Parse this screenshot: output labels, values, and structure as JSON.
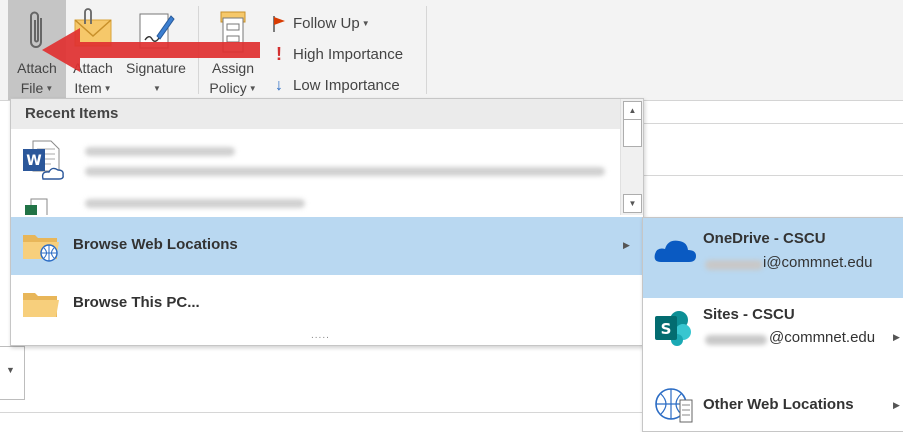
{
  "ribbon": {
    "attach_file": {
      "line1": "Attach",
      "line2": "File",
      "icon": "paperclip-icon"
    },
    "attach_item": {
      "line1": "Attach",
      "line2": "Item",
      "icon": "envelope-paperclip-icon"
    },
    "signature": {
      "line1": "Signature",
      "icon": "signature-pen-icon"
    },
    "assign_policy": {
      "line1": "Assign",
      "line2": "Policy",
      "icon": "policy-cabinet-icon"
    },
    "tags": {
      "follow_up": "Follow Up",
      "high_importance": "High Importance",
      "low_importance": "Low Importance"
    }
  },
  "dropdown": {
    "header": "Recent Items",
    "browse_web": "Browse Web Locations",
    "browse_pc": "Browse This PC...",
    "resize_handle": "....."
  },
  "submenu": {
    "onedrive": {
      "title": "OneDrive - CSCU",
      "email_suffix": "i@commnet.edu"
    },
    "sites": {
      "title": "Sites - CSCU",
      "email_suffix": "@commnet.edu"
    },
    "other": {
      "title": "Other Web Locations"
    }
  },
  "colors": {
    "highlight": "#b9d8f1",
    "selected_ribbon_button": "#c5c5c5",
    "annotation_arrow": "#e03030",
    "word_blue": "#2b579a",
    "onedrive_blue": "#0a5ac2",
    "sharepoint_teal": "#036c70",
    "flag_red": "#d83b01"
  }
}
